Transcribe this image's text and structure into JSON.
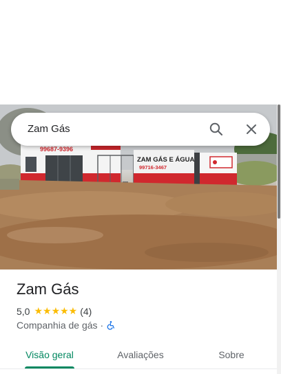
{
  "search": {
    "query": "Zam Gás"
  },
  "photo": {
    "sign_phone_left": "99687-9396",
    "sign_main": "ZAM GÁS E ÁGUA",
    "sign_phone_right": "99716-3467"
  },
  "place": {
    "name": "Zam Gás",
    "rating": "5,0",
    "stars": "★★★★★",
    "review_count": "(4)",
    "category": "Companhia de gás",
    "separator": "·"
  },
  "tabs": [
    {
      "label": "Visão geral"
    },
    {
      "label": "Avaliações"
    },
    {
      "label": "Sobre"
    }
  ],
  "colors": {
    "accent": "#01875f",
    "star": "#fbbc04",
    "wheelchair": "#1a73e8"
  },
  "icons": [
    "search-icon",
    "close-icon",
    "wheelchair-icon"
  ]
}
